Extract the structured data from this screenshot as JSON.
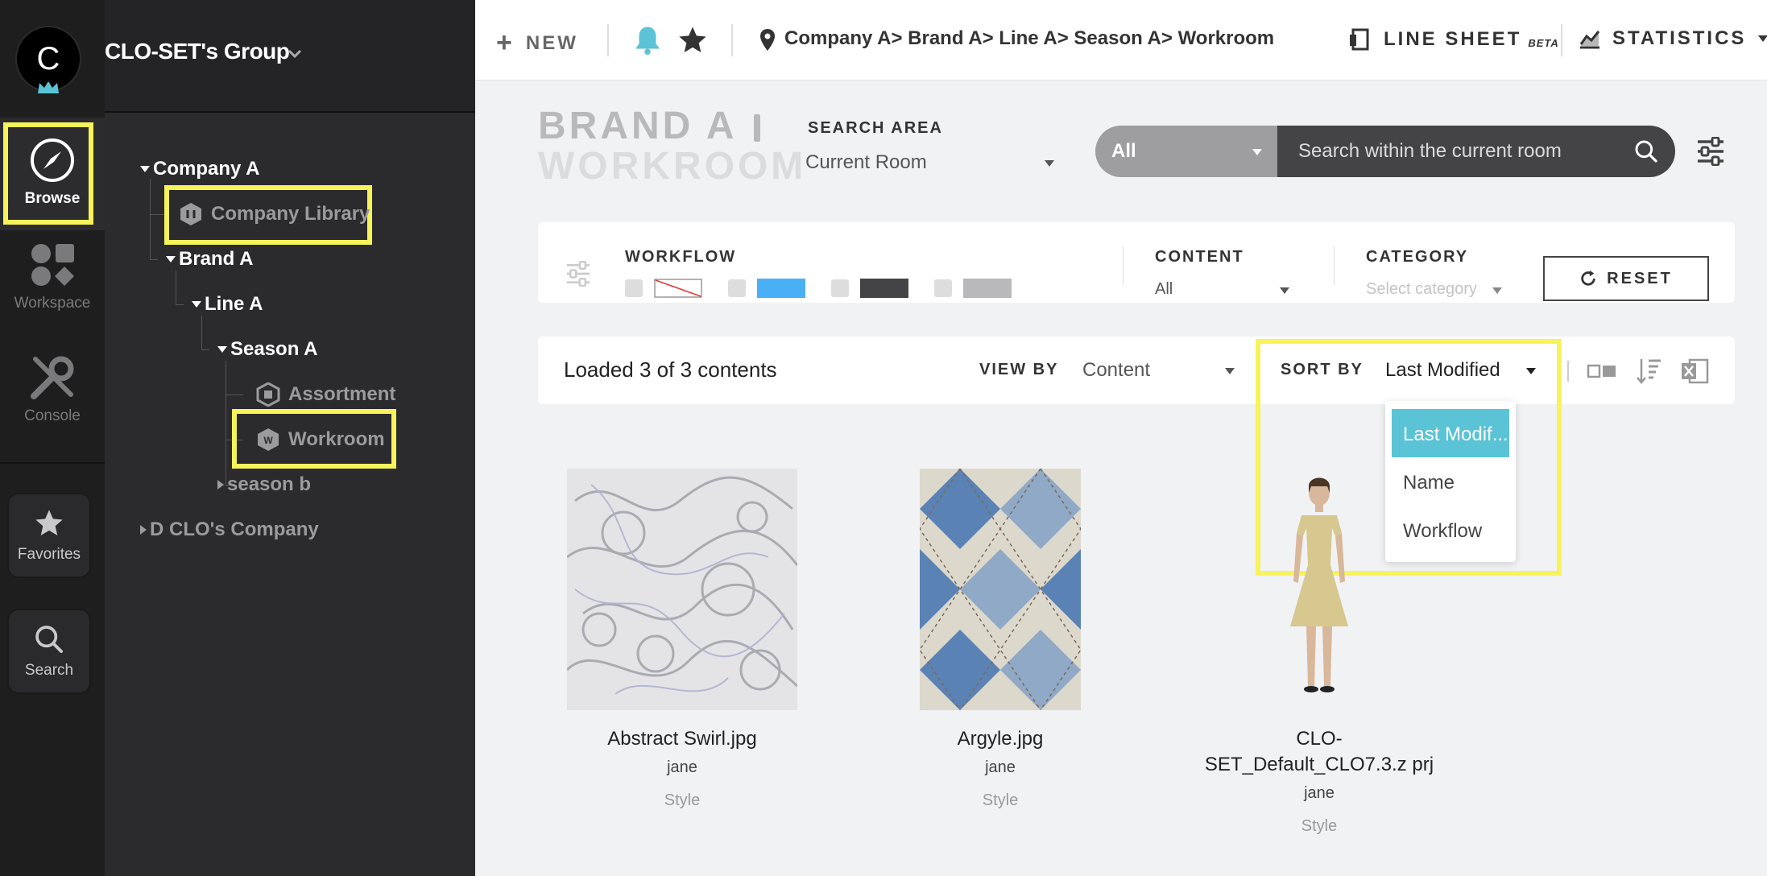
{
  "colors": {
    "accent": "#5bc3d6",
    "highlight": "#f7f35a",
    "rail_bg": "#1e1e1f",
    "tree_bg": "#2b2b2d"
  },
  "rail": {
    "avatar_letter": "C",
    "items": [
      {
        "label": "Browse",
        "icon": "compass-icon"
      },
      {
        "label": "Workspace",
        "icon": "shapes-icon"
      },
      {
        "label": "Console",
        "icon": "tools-icon"
      },
      {
        "label": "Favorites",
        "icon": "star-icon"
      },
      {
        "label": "Search",
        "icon": "search-icon"
      }
    ]
  },
  "tree": {
    "group_name": "CLO-SET's Group",
    "nodes": [
      {
        "label": "Company A"
      },
      {
        "label": "Company Library"
      },
      {
        "label": "Brand A"
      },
      {
        "label": "Line A"
      },
      {
        "label": "Season A"
      },
      {
        "label": "Assortment"
      },
      {
        "label": "Workroom"
      },
      {
        "label": "season b"
      },
      {
        "label": "D CLO's Company"
      }
    ]
  },
  "topbar": {
    "new_label": "NEW",
    "breadcrumb": "Company A> Brand A> Line A> Season A> Workroom",
    "line_sheet": "LINE SHEET",
    "beta": "BETA",
    "statistics": "STATISTICS"
  },
  "header": {
    "title_line1": "BRAND A",
    "title_line2": "WORKROOM",
    "search_area_label": "SEARCH AREA",
    "search_area_value": "Current Room",
    "filter_value": "All",
    "search_placeholder": "Search within the current room"
  },
  "filters": {
    "workflow_label": "WORKFLOW",
    "content_label": "CONTENT",
    "content_value": "All",
    "category_label": "CATEGORY",
    "category_placeholder": "Select category",
    "reset_label": "RESET",
    "workflow_colors": [
      "#ffffff",
      "#4ab0f5",
      "#444446",
      "#b9b9bb"
    ]
  },
  "list": {
    "loaded_text": "Loaded 3 of 3 contents",
    "view_by_label": "VIEW BY",
    "view_by_value": "Content",
    "sort_by_label": "SORT BY",
    "sort_by_value": "Last Modified",
    "sort_options": [
      "Last Modif...",
      "Name",
      "Workflow"
    ]
  },
  "items": [
    {
      "name": "Abstract Swirl.jpg",
      "owner": "jane",
      "type": "Style"
    },
    {
      "name": "Argyle.jpg",
      "owner": "jane",
      "type": "Style"
    },
    {
      "name": "CLO-SET_Default_CLO7.3.z prj",
      "owner": "jane",
      "type": "Style"
    }
  ]
}
